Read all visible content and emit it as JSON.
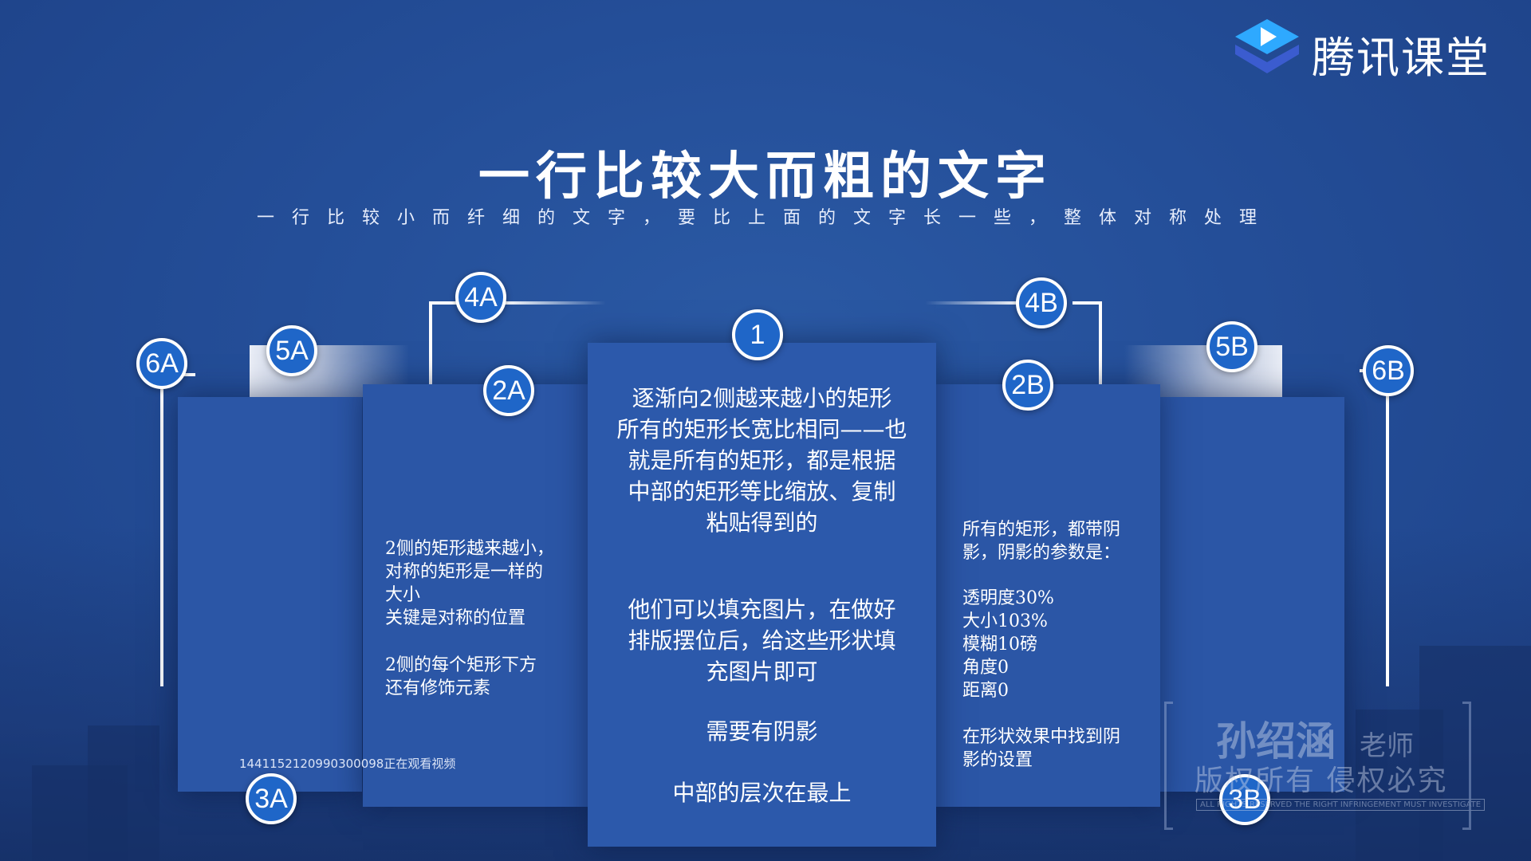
{
  "brand": {
    "name": "腾讯课堂",
    "logo_icon": "play-triangle-logo-icon",
    "colors": {
      "logo_top": "#2ea9ff",
      "logo_bottom": "#3b5ccf"
    }
  },
  "slide": {
    "title": "一行比较大而粗的文字",
    "subtitle": "一行比较小而纤细的文字，要比上面的文字长一些，整体对称处理"
  },
  "badges": {
    "b1": "1",
    "b2a": "2A",
    "b2b": "2B",
    "b3a": "3A",
    "b3b": "3B",
    "b4a": "4A",
    "b4b": "4B",
    "b5a": "5A",
    "b5b": "5B",
    "b6a": "6A",
    "b6b": "6B"
  },
  "center_card": {
    "para1": "逐渐向2侧越来越小的矩形\n所有的矩形长宽比相同——也\n就是所有的矩形，都是根据\n中部的矩形等比缩放、复制\n粘贴得到的",
    "para2": "他们可以填充图片，在做好\n排版摆位后，给这些形状填\n充图片即可",
    "para3": "需要有阴影",
    "para4": "中部的层次在最上"
  },
  "left_card": {
    "para1": "2侧的矩形越来越小，\n对称的矩形是一样的\n大小\n关键是对称的位置",
    "para2": "2侧的每个矩形下方\n还有修饰元素"
  },
  "right_card": {
    "para1": "所有的矩形，都带阴\n影，阴影的参数是：",
    "para2": "透明度30%\n大小103%\n模糊10磅\n角度0\n距离0",
    "para3": "在形状效果中找到阴\n影的设置"
  },
  "overlay": {
    "viewer_text": "1441152120990300098正在观看视频"
  },
  "watermark": {
    "name": "孙绍涵",
    "role": "老师",
    "rights": "版权所有 侵权必究",
    "rights_en": "ALL RIGHTS RESERVED THE RIGHT INFRINGEMENT MUST INVESTIGATE"
  },
  "colors": {
    "background": "#244e98",
    "card": "#2b56a6",
    "badge": "#1f66c8",
    "line": "#ffffff"
  }
}
